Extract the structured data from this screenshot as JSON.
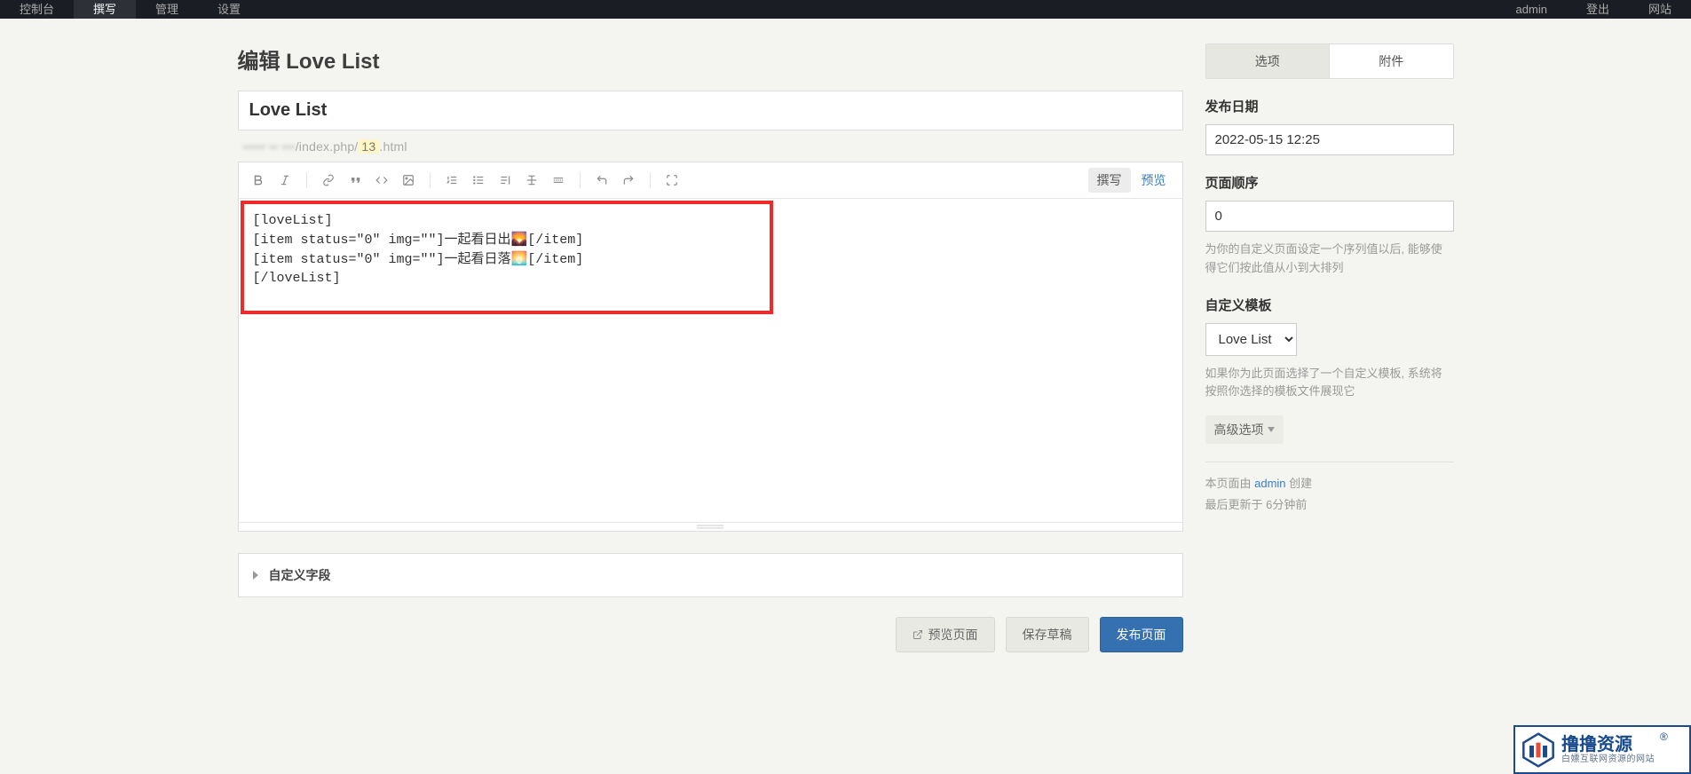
{
  "topnav": {
    "left": [
      "控制台",
      "撰写",
      "管理",
      "设置"
    ],
    "active_left_index": 1,
    "right": [
      "admin",
      "登出",
      "网站"
    ]
  },
  "page": {
    "heading": "编辑 Love List",
    "title_value": "Love List",
    "slug_prefix": "/index.php/",
    "slug_id": "13",
    "slug_suffix": ".html"
  },
  "toolbar": {
    "mode_compose": "撰写",
    "mode_preview": "预览"
  },
  "editor": {
    "content": "[loveList]\n[item status=\"0\" img=\"\"]一起看日出🌄[/item]\n[item status=\"0\" img=\"\"]一起看日落🌅[/item]\n[/loveList]"
  },
  "custom_fields": {
    "label": "自定义字段"
  },
  "actions": {
    "preview_page": "预览页面",
    "save_draft": "保存草稿",
    "publish": "发布页面"
  },
  "sidebar": {
    "tabs": {
      "options": "选项",
      "attachments": "附件"
    },
    "publish_date": {
      "label": "发布日期",
      "value": "2022-05-15 12:25"
    },
    "page_order": {
      "label": "页面顺序",
      "value": "0",
      "help": "为你的自定义页面设定一个序列值以后, 能够使得它们按此值从小到大排列"
    },
    "custom_template": {
      "label": "自定义模板",
      "value": "Love List",
      "help": "如果你为此页面选择了一个自定义模板, 系统将按照你选择的模板文件展现它"
    },
    "advanced": "高级选项",
    "meta": {
      "created_prefix": "本页面由 ",
      "created_user": "admin",
      "created_suffix": " 创建",
      "updated": "最后更新于 6分钟前"
    }
  },
  "watermark": {
    "big": "撸撸资源",
    "small": "白嫖互联网资源的网站"
  }
}
